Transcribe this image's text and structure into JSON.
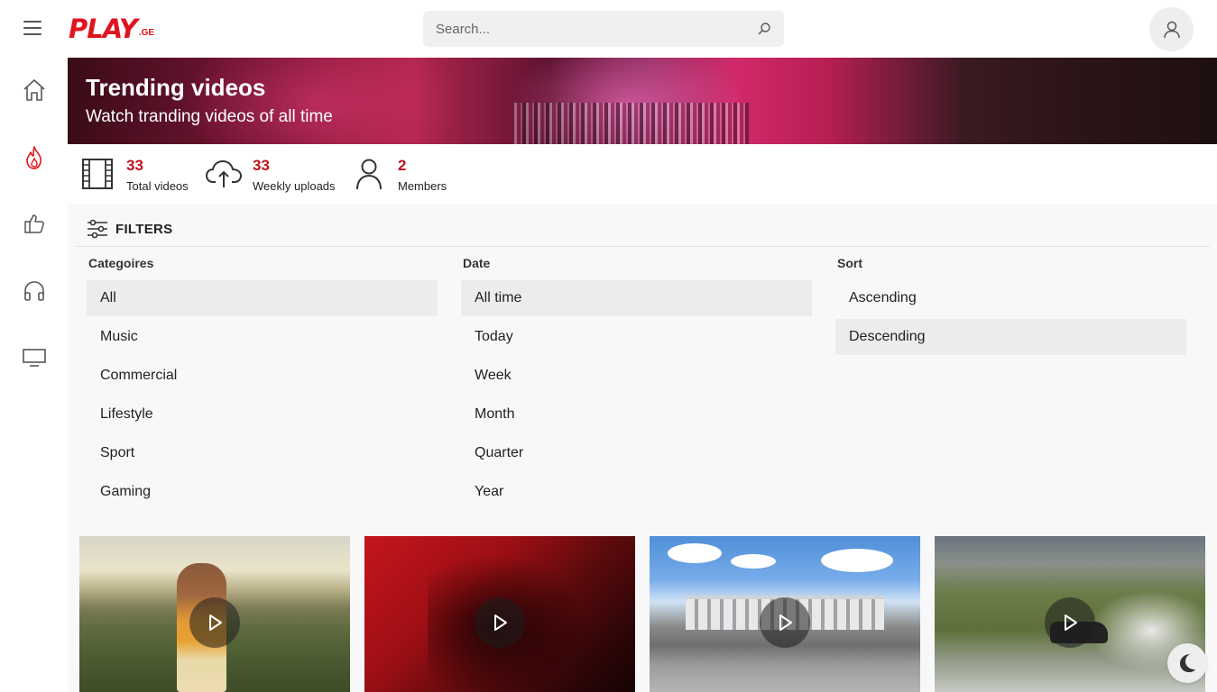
{
  "header": {
    "logo_text": "PLAY",
    "logo_suffix": ".GE",
    "search_placeholder": "Search...",
    "icons": {
      "menu": "hamburger-icon",
      "search": "search-icon",
      "account": "user-icon"
    }
  },
  "sidebar": {
    "items": [
      {
        "name": "home",
        "icon": "home-icon"
      },
      {
        "name": "trending",
        "icon": "fire-icon",
        "active": true,
        "color": "#e0141e"
      },
      {
        "name": "liked",
        "icon": "thumbs-up-icon"
      },
      {
        "name": "music",
        "icon": "headphones-icon"
      },
      {
        "name": "tv",
        "icon": "monitor-icon"
      }
    ]
  },
  "banner": {
    "title": "Trending videos",
    "subtitle": "Watch tranding videos of all time"
  },
  "stats": [
    {
      "value": "33",
      "label": "Total videos",
      "icon": "film-icon"
    },
    {
      "value": "33",
      "label": "Weekly uploads",
      "icon": "cloud-upload-icon"
    },
    {
      "value": "2",
      "label": "Members",
      "icon": "user-icon"
    }
  ],
  "filters": {
    "title": "FILTERS",
    "columns": [
      {
        "title": "Categoires",
        "options": [
          "All",
          "Music",
          "Commercial",
          "Lifestyle",
          "Sport",
          "Gaming"
        ],
        "selected": "All"
      },
      {
        "title": "Date",
        "options": [
          "All time",
          "Today",
          "Week",
          "Month",
          "Quarter",
          "Year"
        ],
        "selected": "All time"
      },
      {
        "title": "Sort",
        "options": [
          "Ascending",
          "Descending"
        ],
        "selected": "Descending"
      }
    ]
  },
  "videos": [
    {
      "thumbnail": "woman-in-wheat-field"
    },
    {
      "thumbnail": "red-silhouette"
    },
    {
      "thumbnail": "racetrack-grandstand"
    },
    {
      "thumbnail": "drifting-car-smoke"
    }
  ],
  "colors": {
    "accent": "#c0121b",
    "brand": "#e0141e",
    "filter_active_bg": "#ececec"
  },
  "theme_toggle_icon": "moon-icon"
}
